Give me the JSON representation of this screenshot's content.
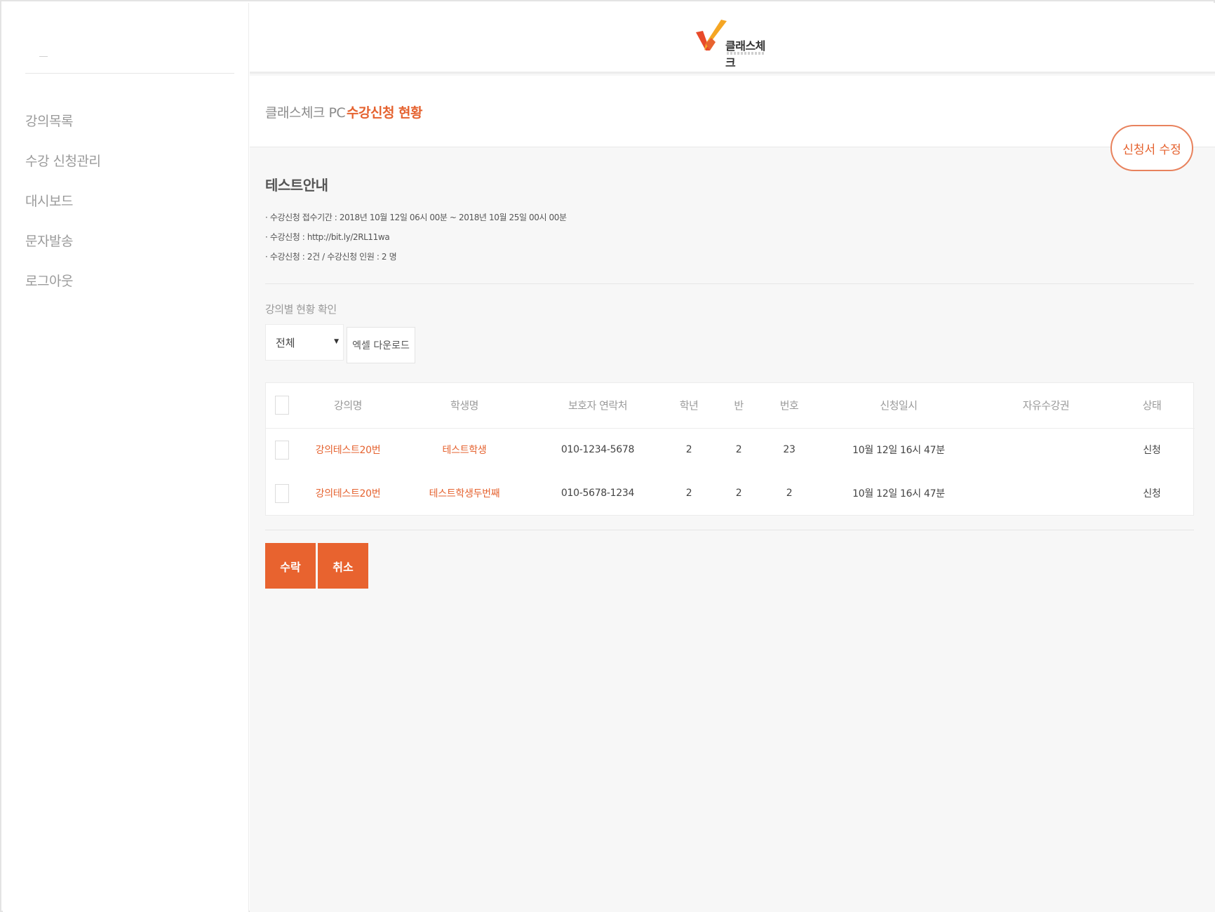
{
  "sidebar": {
    "items": [
      {
        "label": "강의목록"
      },
      {
        "label": "수강 신청관리"
      },
      {
        "label": "대시보드"
      },
      {
        "label": "문자발송"
      },
      {
        "label": "로그아웃"
      }
    ]
  },
  "header": {
    "brand_name": "클래스체크"
  },
  "breadcrumb": {
    "root": "클래스체크 PC",
    "current": "수강신청 현황"
  },
  "edit_button_label": "신청서 수정",
  "info": {
    "title": "테스트안내",
    "lines": [
      "· 수강신청 접수기간 : 2018년 10월 12일 06시 00분 ~ 2018년 10월 25일 00시 00분",
      "· 수강신청 : http://bit.ly/2RL11wa",
      "· 수강신청 : 2건 / 수강신청 인원 : 2 명"
    ]
  },
  "filter": {
    "label": "강의별 현황 확인",
    "select_value": "전체",
    "excel_label": "엑셀 다운로드"
  },
  "table": {
    "headers": [
      "강의명",
      "학생명",
      "보호자 연락처",
      "학년",
      "반",
      "번호",
      "신청일시",
      "자유수강권",
      "상태"
    ],
    "rows": [
      {
        "course": "강의테스트20번",
        "student": "테스트학생",
        "phone": "010-1234-5678",
        "grade": "2",
        "class": "2",
        "number": "23",
        "date": "10월 12일 16시 47분",
        "pass": "",
        "status": "신청"
      },
      {
        "course": "강의테스트20번",
        "student": "테스트학생두번째",
        "phone": "010-5678-1234",
        "grade": "2",
        "class": "2",
        "number": "2",
        "date": "10월 12일 16시 47분",
        "pass": "",
        "status": "신청"
      }
    ]
  },
  "actions": {
    "accept_label": "수락",
    "cancel_label": "취소"
  },
  "colors": {
    "accent": "#e5622f",
    "button": "#e8632f"
  }
}
